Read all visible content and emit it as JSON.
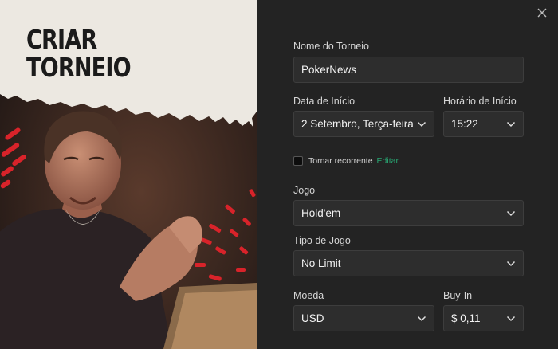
{
  "hero": {
    "title_line1": "CRIAR",
    "title_line2": "TORNEIO"
  },
  "form": {
    "close_icon": "close-icon",
    "tournament_name": {
      "label": "Nome do Torneio",
      "value": "PokerNews"
    },
    "start_date": {
      "label": "Data de Início",
      "value": "2 Setembro, Terça-feira"
    },
    "start_time": {
      "label": "Horário de Início",
      "value": "15:22"
    },
    "recurring": {
      "label": "Tornar recorrente",
      "edit_label": "Editar",
      "checked": false
    },
    "game": {
      "label": "Jogo",
      "value": "Hold'em"
    },
    "game_type": {
      "label": "Tipo de Jogo",
      "value": "No Limit"
    },
    "currency": {
      "label": "Moeda",
      "value": "USD"
    },
    "buy_in": {
      "label": "Buy-In",
      "value": "$ 0,11"
    }
  },
  "colors": {
    "panel_bg": "#232323",
    "field_bg": "#2d2d2d",
    "accent_link": "#28a672",
    "paper": "#ece8e1",
    "hero_red": "#d8232a"
  }
}
